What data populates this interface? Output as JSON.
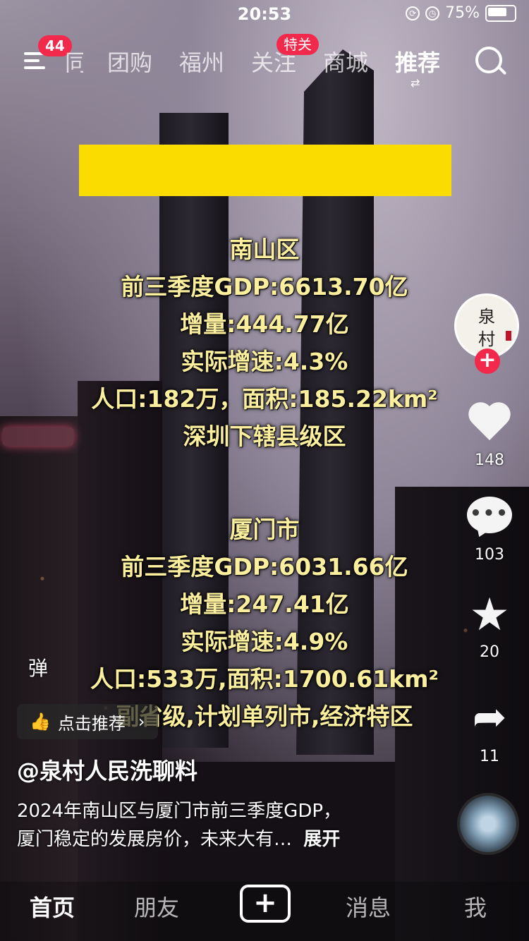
{
  "status_bar": {
    "time": "20:53",
    "battery": "75%"
  },
  "top_nav": {
    "menu_badge": "44",
    "tabs": [
      "团购",
      "福州",
      "关注",
      "商城",
      "推荐"
    ],
    "partial_tab": "同城",
    "follow_badge": "特关",
    "active_tab": "推荐"
  },
  "video_text": {
    "block1": [
      "南山区",
      "前三季度GDP:6613.70亿",
      "增量:444.77亿",
      "实际增速:4.3%",
      "人口:182万，面积:185.22km²",
      "深圳下辖县级区"
    ],
    "block2": [
      "厦门市",
      "前三季度GDP:6031.66亿",
      "增量:247.41亿",
      "实际增速:4.9%",
      "人口:533万,面积:1700.61km²",
      "副省级,计划单列市,经济特区"
    ]
  },
  "right_rail": {
    "avatar_text_1": "泉",
    "avatar_text_2": "村",
    "likes": "148",
    "comments": "103",
    "favorites": "20",
    "shares": "11"
  },
  "overlay": {
    "danmu": "弹",
    "recommend_pill": "点击推荐",
    "author": "@泉村人民洗聊料",
    "desc_line1": "2024年南山区与厦门市前三季度GDP，",
    "desc_line2": "厦门稳定的发展房价，未来大有…",
    "expand": "展开"
  },
  "bottom_tabs": {
    "home": "首页",
    "friends": "朋友",
    "add": "+",
    "messages": "消息",
    "me": "我"
  },
  "colors": {
    "accent_red": "#f2294b",
    "banner_yellow": "#fbdc00",
    "caption_yellow": "#fbef9e"
  }
}
